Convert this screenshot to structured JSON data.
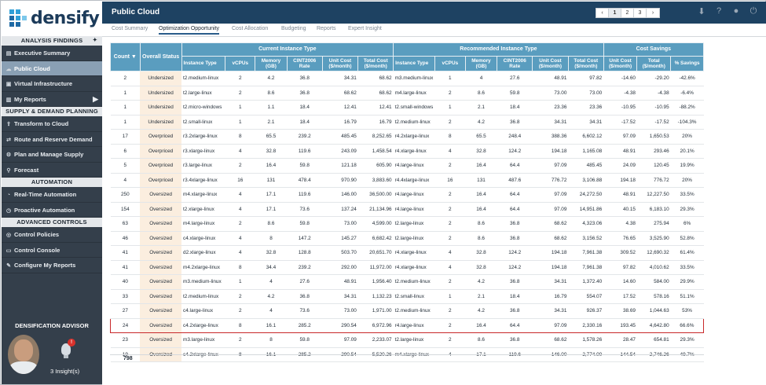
{
  "app": {
    "logo_text": "densify",
    "page_title": "Public Cloud"
  },
  "pager": {
    "prev": "‹",
    "pages": [
      "1",
      "2",
      "3"
    ],
    "next": "›"
  },
  "sidebar": {
    "analysis_findings": "ANALYSIS FINDINGS",
    "executive_summary": "Executive Summary",
    "public_cloud": "Public Cloud",
    "virtual_infrastructure": "Virtual Infrastructure",
    "my_reports": "My Reports",
    "supply_demand": "SUPPLY & DEMAND PLANNING",
    "transform_to_cloud": "Transform to Cloud",
    "route_reserve": "Route and Reserve Demand",
    "plan_manage": "Plan and Manage Supply",
    "forecast": "Forecast",
    "automation": "AUTOMATION",
    "realtime_automation": "Real-Time Automation",
    "proactive_automation": "Proactive Automation",
    "advanced_controls": "ADVANCED CONTROLS",
    "control_policies": "Control Policies",
    "control_console": "Control Console",
    "configure_reports": "Configure My Reports"
  },
  "advisor": {
    "title": "DENSIFICATION ADVISOR",
    "insights": "3 Insight(s)",
    "badge": "!"
  },
  "tabs": {
    "cost_summary": "Cost Summary",
    "optimization": "Optimization Opportunity",
    "cost_allocation": "Cost Allocation",
    "budgeting": "Budgeting",
    "reports": "Reports",
    "expert_insight": "Expert Insight"
  },
  "table": {
    "groups": {
      "current": "Current Instance Type",
      "recommended": "Recommended Instance Type",
      "savings": "Cost Savings"
    },
    "headers": {
      "count": "Count ▼",
      "status": "Overall Status",
      "cur_type": "Instance Type",
      "cur_vcpus": "vCPUs",
      "cur_mem": "Memory (GB)",
      "cur_cint": "CINT2006 Rate",
      "cur_unit": "Unit Cost ($/month)",
      "cur_total": "Total Cost ($/month)",
      "rec_type": "Instance Type",
      "rec_vcpus": "vCPUs",
      "rec_mem": "Memory (GB)",
      "rec_cint": "CINT2006 Rate",
      "rec_unit": "Unit Cost ($/month)",
      "rec_total": "Total Cost ($/month)",
      "sav_unit": "Unit Cost ($/month)",
      "sav_total": "Total ($/month)",
      "sav_pct": "% Savings"
    },
    "rows": [
      {
        "count": "2",
        "status": "Undersized",
        "cur_type": "t2.medium-linux",
        "cur_vcpus": "2",
        "cur_mem": "4.2",
        "cur_cint": "36.8",
        "cur_unit": "34.31",
        "cur_total": "68.62",
        "rec_type": "m3.medium-linux",
        "rec_vcpus": "1",
        "rec_mem": "4",
        "rec_cint": "27.6",
        "rec_unit": "48.91",
        "rec_total": "97.82",
        "sav_unit": "-14.60",
        "sav_total": "-29.20",
        "sav_pct": "-42.6%"
      },
      {
        "count": "1",
        "status": "Undersized",
        "cur_type": "t2.large-linux",
        "cur_vcpus": "2",
        "cur_mem": "8.6",
        "cur_cint": "36.8",
        "cur_unit": "68.62",
        "cur_total": "68.62",
        "rec_type": "m4.large-linux",
        "rec_vcpus": "2",
        "rec_mem": "8.6",
        "rec_cint": "59.8",
        "rec_unit": "73.00",
        "rec_total": "73.00",
        "sav_unit": "-4.38",
        "sav_total": "-4.38",
        "sav_pct": "-6.4%"
      },
      {
        "count": "1",
        "status": "Undersized",
        "cur_type": "t2.micro-windows",
        "cur_vcpus": "1",
        "cur_mem": "1.1",
        "cur_cint": "18.4",
        "cur_unit": "12.41",
        "cur_total": "12.41",
        "rec_type": "t2.small-windows",
        "rec_vcpus": "1",
        "rec_mem": "2.1",
        "rec_cint": "18.4",
        "rec_unit": "23.36",
        "rec_total": "23.36",
        "sav_unit": "-10.95",
        "sav_total": "-10.95",
        "sav_pct": "-88.2%"
      },
      {
        "count": "1",
        "status": "Undersized",
        "cur_type": "t2.small-linux",
        "cur_vcpus": "1",
        "cur_mem": "2.1",
        "cur_cint": "18.4",
        "cur_unit": "16.79",
        "cur_total": "16.79",
        "rec_type": "t2.medium-linux",
        "rec_vcpus": "2",
        "rec_mem": "4.2",
        "rec_cint": "36.8",
        "rec_unit": "34.31",
        "rec_total": "34.31",
        "sav_unit": "-17.52",
        "sav_total": "-17.52",
        "sav_pct": "-104.3%"
      },
      {
        "count": "17",
        "status": "Overpriced",
        "cur_type": "r3.2xlarge-linux",
        "cur_vcpus": "8",
        "cur_mem": "65.5",
        "cur_cint": "239.2",
        "cur_unit": "485.45",
        "cur_total": "8,252.65",
        "rec_type": "r4.2xlarge-linux",
        "rec_vcpus": "8",
        "rec_mem": "65.5",
        "rec_cint": "248.4",
        "rec_unit": "388.36",
        "rec_total": "6,602.12",
        "sav_unit": "97.09",
        "sav_total": "1,650.53",
        "sav_pct": "20%"
      },
      {
        "count": "6",
        "status": "Overpriced",
        "cur_type": "r3.xlarge-linux",
        "cur_vcpus": "4",
        "cur_mem": "32.8",
        "cur_cint": "119.6",
        "cur_unit": "243.09",
        "cur_total": "1,458.54",
        "rec_type": "r4.xlarge-linux",
        "rec_vcpus": "4",
        "rec_mem": "32.8",
        "rec_cint": "124.2",
        "rec_unit": "194.18",
        "rec_total": "1,165.08",
        "sav_unit": "48.91",
        "sav_total": "293.46",
        "sav_pct": "20.1%"
      },
      {
        "count": "5",
        "status": "Overpriced",
        "cur_type": "r3.large-linux",
        "cur_vcpus": "2",
        "cur_mem": "16.4",
        "cur_cint": "59.8",
        "cur_unit": "121.18",
        "cur_total": "605.90",
        "rec_type": "r4.large-linux",
        "rec_vcpus": "2",
        "rec_mem": "16.4",
        "rec_cint": "64.4",
        "rec_unit": "97.09",
        "rec_total": "485.45",
        "sav_unit": "24.09",
        "sav_total": "120.45",
        "sav_pct": "19.9%"
      },
      {
        "count": "4",
        "status": "Overpriced",
        "cur_type": "r3.4xlarge-linux",
        "cur_vcpus": "16",
        "cur_mem": "131",
        "cur_cint": "478.4",
        "cur_unit": "970.90",
        "cur_total": "3,883.60",
        "rec_type": "r4.4xlarge-linux",
        "rec_vcpus": "16",
        "rec_mem": "131",
        "rec_cint": "487.6",
        "rec_unit": "776.72",
        "rec_total": "3,106.88",
        "sav_unit": "194.18",
        "sav_total": "776.72",
        "sav_pct": "20%"
      },
      {
        "count": "250",
        "status": "Oversized",
        "cur_type": "m4.xlarge-linux",
        "cur_vcpus": "4",
        "cur_mem": "17.1",
        "cur_cint": "119.6",
        "cur_unit": "146.00",
        "cur_total": "36,500.00",
        "rec_type": "r4.large-linux",
        "rec_vcpus": "2",
        "rec_mem": "16.4",
        "rec_cint": "64.4",
        "rec_unit": "97.09",
        "rec_total": "24,272.50",
        "sav_unit": "48.91",
        "sav_total": "12,227.50",
        "sav_pct": "33.5%"
      },
      {
        "count": "154",
        "status": "Oversized",
        "cur_type": "t2.xlarge-linux",
        "cur_vcpus": "4",
        "cur_mem": "17.1",
        "cur_cint": "73.6",
        "cur_unit": "137.24",
        "cur_total": "21,134.96",
        "rec_type": "r4.large-linux",
        "rec_vcpus": "2",
        "rec_mem": "16.4",
        "rec_cint": "64.4",
        "rec_unit": "97.09",
        "rec_total": "14,951.86",
        "sav_unit": "40.15",
        "sav_total": "6,183.10",
        "sav_pct": "29.3%"
      },
      {
        "count": "63",
        "status": "Oversized",
        "cur_type": "m4.large-linux",
        "cur_vcpus": "2",
        "cur_mem": "8.6",
        "cur_cint": "59.8",
        "cur_unit": "73.00",
        "cur_total": "4,599.00",
        "rec_type": "t2.large-linux",
        "rec_vcpus": "2",
        "rec_mem": "8.6",
        "rec_cint": "36.8",
        "rec_unit": "68.62",
        "rec_total": "4,323.06",
        "sav_unit": "4.38",
        "sav_total": "275.94",
        "sav_pct": "6%"
      },
      {
        "count": "46",
        "status": "Oversized",
        "cur_type": "c4.xlarge-linux",
        "cur_vcpus": "4",
        "cur_mem": "8",
        "cur_cint": "147.2",
        "cur_unit": "145.27",
        "cur_total": "6,682.42",
        "rec_type": "t2.large-linux",
        "rec_vcpus": "2",
        "rec_mem": "8.6",
        "rec_cint": "36.8",
        "rec_unit": "68.62",
        "rec_total": "3,156.52",
        "sav_unit": "76.65",
        "sav_total": "3,525.90",
        "sav_pct": "52.8%"
      },
      {
        "count": "41",
        "status": "Oversized",
        "cur_type": "d2.xlarge-linux",
        "cur_vcpus": "4",
        "cur_mem": "32.8",
        "cur_cint": "128.8",
        "cur_unit": "503.70",
        "cur_total": "20,651.70",
        "rec_type": "r4.xlarge-linux",
        "rec_vcpus": "4",
        "rec_mem": "32.8",
        "rec_cint": "124.2",
        "rec_unit": "194.18",
        "rec_total": "7,961.38",
        "sav_unit": "309.52",
        "sav_total": "12,690.32",
        "sav_pct": "61.4%"
      },
      {
        "count": "41",
        "status": "Oversized",
        "cur_type": "m4.2xlarge-linux",
        "cur_vcpus": "8",
        "cur_mem": "34.4",
        "cur_cint": "239.2",
        "cur_unit": "292.00",
        "cur_total": "11,972.00",
        "rec_type": "r4.xlarge-linux",
        "rec_vcpus": "4",
        "rec_mem": "32.8",
        "rec_cint": "124.2",
        "rec_unit": "194.18",
        "rec_total": "7,961.38",
        "sav_unit": "97.82",
        "sav_total": "4,010.62",
        "sav_pct": "33.5%"
      },
      {
        "count": "40",
        "status": "Oversized",
        "cur_type": "m3.medium-linux",
        "cur_vcpus": "1",
        "cur_mem": "4",
        "cur_cint": "27.6",
        "cur_unit": "48.91",
        "cur_total": "1,956.40",
        "rec_type": "t2.medium-linux",
        "rec_vcpus": "2",
        "rec_mem": "4.2",
        "rec_cint": "36.8",
        "rec_unit": "34.31",
        "rec_total": "1,372.40",
        "sav_unit": "14.60",
        "sav_total": "584.00",
        "sav_pct": "29.9%"
      },
      {
        "count": "33",
        "status": "Oversized",
        "cur_type": "t2.medium-linux",
        "cur_vcpus": "2",
        "cur_mem": "4.2",
        "cur_cint": "36.8",
        "cur_unit": "34.31",
        "cur_total": "1,132.23",
        "rec_type": "t2.small-linux",
        "rec_vcpus": "1",
        "rec_mem": "2.1",
        "rec_cint": "18.4",
        "rec_unit": "16.79",
        "rec_total": "554.07",
        "sav_unit": "17.52",
        "sav_total": "578.16",
        "sav_pct": "51.1%"
      },
      {
        "count": "27",
        "status": "Oversized",
        "cur_type": "c4.large-linux",
        "cur_vcpus": "2",
        "cur_mem": "4",
        "cur_cint": "73.6",
        "cur_unit": "73.00",
        "cur_total": "1,971.00",
        "rec_type": "t2.medium-linux",
        "rec_vcpus": "2",
        "rec_mem": "4.2",
        "rec_cint": "36.8",
        "rec_unit": "34.31",
        "rec_total": "926.37",
        "sav_unit": "38.69",
        "sav_total": "1,044.63",
        "sav_pct": "53%"
      },
      {
        "count": "24",
        "status": "Oversized",
        "cur_type": "c4.2xlarge-linux",
        "cur_vcpus": "8",
        "cur_mem": "16.1",
        "cur_cint": "285.2",
        "cur_unit": "290.54",
        "cur_total": "6,972.96",
        "rec_type": "r4.large-linux",
        "rec_vcpus": "2",
        "rec_mem": "16.4",
        "rec_cint": "64.4",
        "rec_unit": "97.09",
        "rec_total": "2,330.16",
        "sav_unit": "193.45",
        "sav_total": "4,642.80",
        "sav_pct": "66.6%"
      },
      {
        "count": "23",
        "status": "Oversized",
        "cur_type": "m3.large-linux",
        "cur_vcpus": "2",
        "cur_mem": "8",
        "cur_cint": "59.8",
        "cur_unit": "97.09",
        "cur_total": "2,233.07",
        "rec_type": "t2.large-linux",
        "rec_vcpus": "2",
        "rec_mem": "8.6",
        "rec_cint": "36.8",
        "rec_unit": "68.62",
        "rec_total": "1,578.26",
        "sav_unit": "28.47",
        "sav_total": "654.81",
        "sav_pct": "29.3%"
      },
      {
        "count": "19",
        "status": "Oversized",
        "cur_type": "c4.2xlarge-linux",
        "cur_vcpus": "8",
        "cur_mem": "16.1",
        "cur_cint": "285.2",
        "cur_unit": "290.54",
        "cur_total": "5,520.26",
        "rec_type": "m4.xlarge-linux",
        "rec_vcpus": "4",
        "rec_mem": "17.1",
        "rec_cint": "119.6",
        "rec_unit": "146.00",
        "rec_total": "2,774.00",
        "sav_unit": "144.54",
        "sav_total": "2,746.26",
        "sav_pct": "49.7%"
      }
    ],
    "total_count": "798"
  }
}
